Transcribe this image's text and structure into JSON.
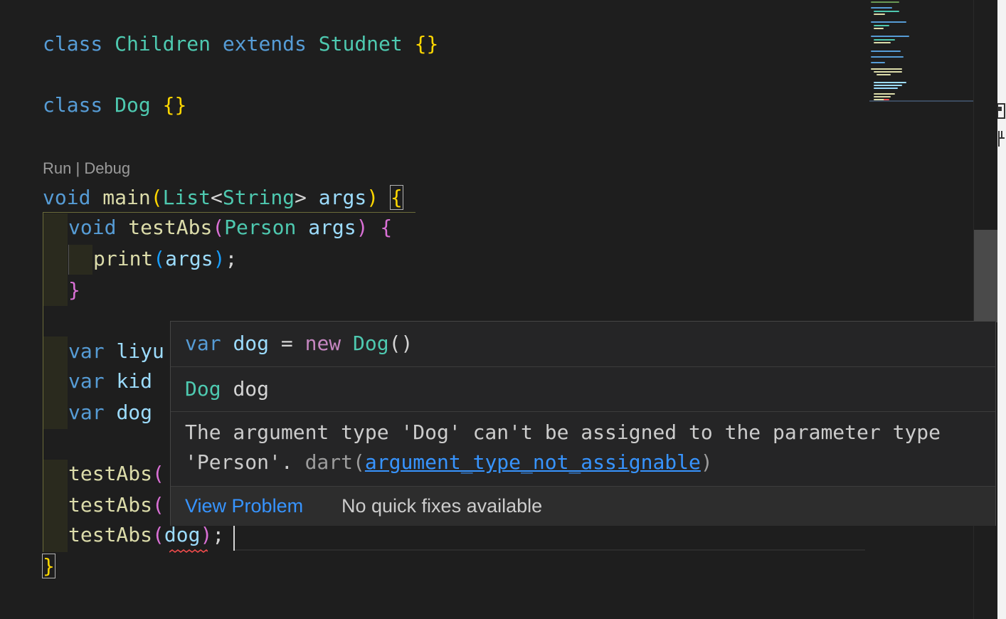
{
  "editor": {
    "lines": {
      "l1": {
        "kw": "class",
        "name": "Children",
        "kw2": "extends",
        "parent": "Studnet",
        "braces": "{}"
      },
      "l2": {
        "kw": "class",
        "name": "Dog",
        "braces": "{}"
      },
      "codelens": {
        "run": "Run",
        "sep": " | ",
        "debug": "Debug"
      },
      "l3": {
        "kw": "void",
        "fn": "main",
        "p1": "(",
        "type": "List",
        "lt": "<",
        "gen": "String",
        "gt": ">",
        "arg": "args",
        "p2": ")",
        "brace": "{"
      },
      "l4": {
        "kw": "void",
        "fn": "testAbs",
        "p1": "(",
        "type": "Person",
        "arg": "args",
        "p2": ")",
        "brace": "{"
      },
      "l5": {
        "fn": "print",
        "p1": "(",
        "arg": "args",
        "p2": ")",
        "semi": ";"
      },
      "l6": {
        "brace": "}"
      },
      "l7": {
        "kw": "var",
        "id": "liyu"
      },
      "l8": {
        "kw": "var",
        "id": "kid"
      },
      "l9": {
        "kw": "var",
        "id": "dog"
      },
      "l10": {
        "fn": "testAbs",
        "p1": "("
      },
      "l11": {
        "fn": "testAbs",
        "p1": "("
      },
      "l12": {
        "fn": "testAbs",
        "p1": "(",
        "arg": "dog",
        "p2": ")",
        "semi": ";"
      },
      "l13": {
        "brace": "}"
      }
    }
  },
  "hover": {
    "decl": {
      "kw": "var",
      "id": "dog",
      "eq": "=",
      "nw": "new",
      "type": "Dog",
      "parens": "()"
    },
    "typeinfo": {
      "type": "Dog",
      "id": "dog"
    },
    "message": {
      "line1": "The argument type 'Dog' can't be assigned to the parameter type",
      "line2_pre": "'Person'. ",
      "source": "dart(",
      "code": "argument_type_not_assignable",
      "source_end": ")"
    },
    "actions": {
      "view_problem": "View Problem",
      "no_fixes": "No quick fixes available"
    }
  },
  "colors": {
    "background": "#1e1e1e",
    "keyword": "#569cd6",
    "type": "#4ec9b0",
    "function": "#dcdcaa",
    "identifier": "#9cdcfe",
    "link": "#3794ff",
    "error_squiggle": "#f14c4c"
  }
}
